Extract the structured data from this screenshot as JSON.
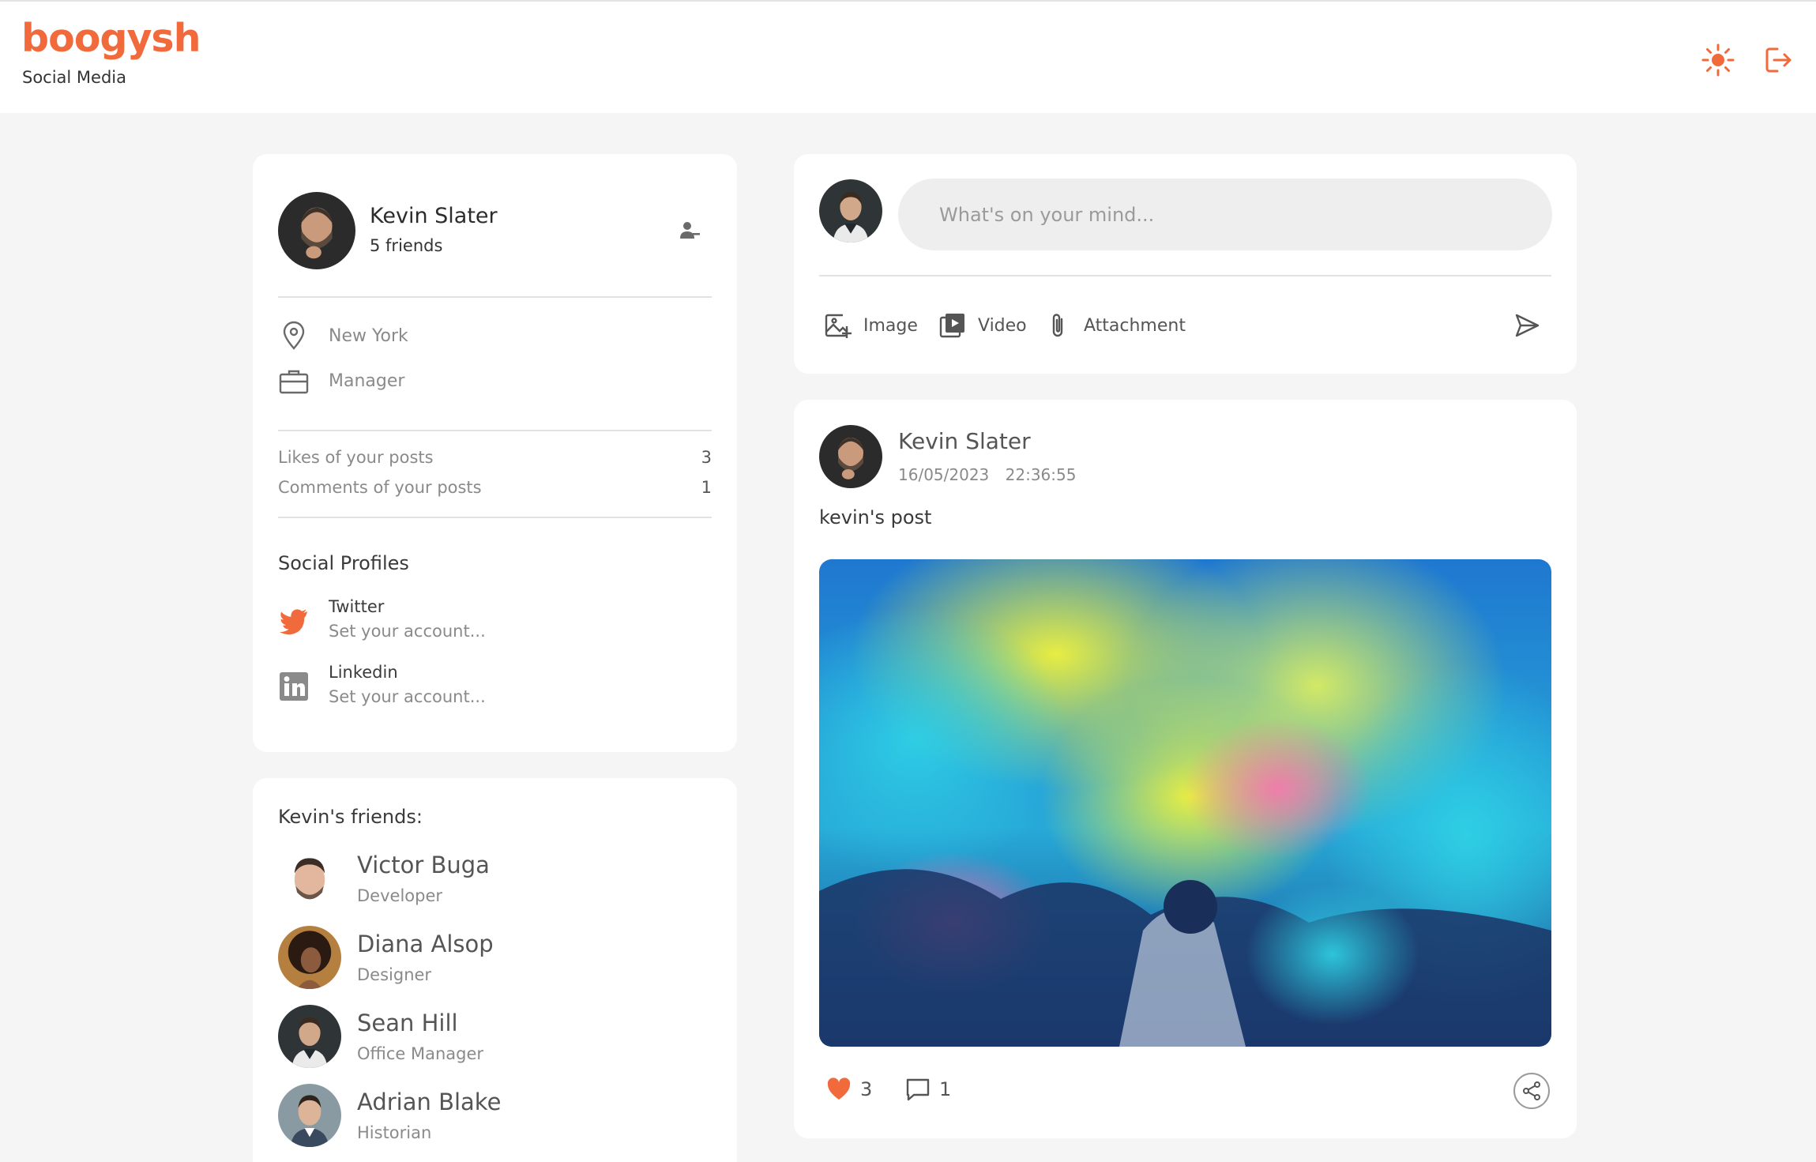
{
  "brand": {
    "logo": "boogysh",
    "tagline": "Social Media"
  },
  "colors": {
    "accent": "#f06a3b",
    "background": "#f5f5f5",
    "card": "#ffffff"
  },
  "header": {
    "theme_icon": "sun-icon",
    "logout_icon": "logout-icon"
  },
  "profile": {
    "name": "Kevin Slater",
    "friends": "5 friends",
    "location": "New York",
    "job": "Manager",
    "stats": [
      {
        "label": "Likes of your posts",
        "value": "3"
      },
      {
        "label": "Comments of your posts",
        "value": "1"
      }
    ],
    "social_title": "Social Profiles",
    "social": [
      {
        "name": "Twitter",
        "sub": "Set your account...",
        "icon": "twitter-icon"
      },
      {
        "name": "Linkedin",
        "sub": "Set your account...",
        "icon": "linkedin-icon"
      }
    ]
  },
  "friends": {
    "title": "Kevin's friends:",
    "items": [
      {
        "name": "Victor Buga",
        "role": "Developer"
      },
      {
        "name": "Diana Alsop",
        "role": "Designer"
      },
      {
        "name": "Sean Hill",
        "role": "Office Manager"
      },
      {
        "name": "Adrian Blake",
        "role": "Historian"
      }
    ]
  },
  "composer": {
    "placeholder": "What's on your mind...",
    "actions": [
      {
        "label": "Image",
        "icon": "image-add-icon"
      },
      {
        "label": "Video",
        "icon": "video-icon"
      },
      {
        "label": "Attachment",
        "icon": "paperclip-icon"
      }
    ],
    "send_icon": "send-icon"
  },
  "post": {
    "author": "Kevin Slater",
    "date": "16/05/2023",
    "time": "22:36:55",
    "text": "kevin's post",
    "likes": "3",
    "comments": "1"
  }
}
